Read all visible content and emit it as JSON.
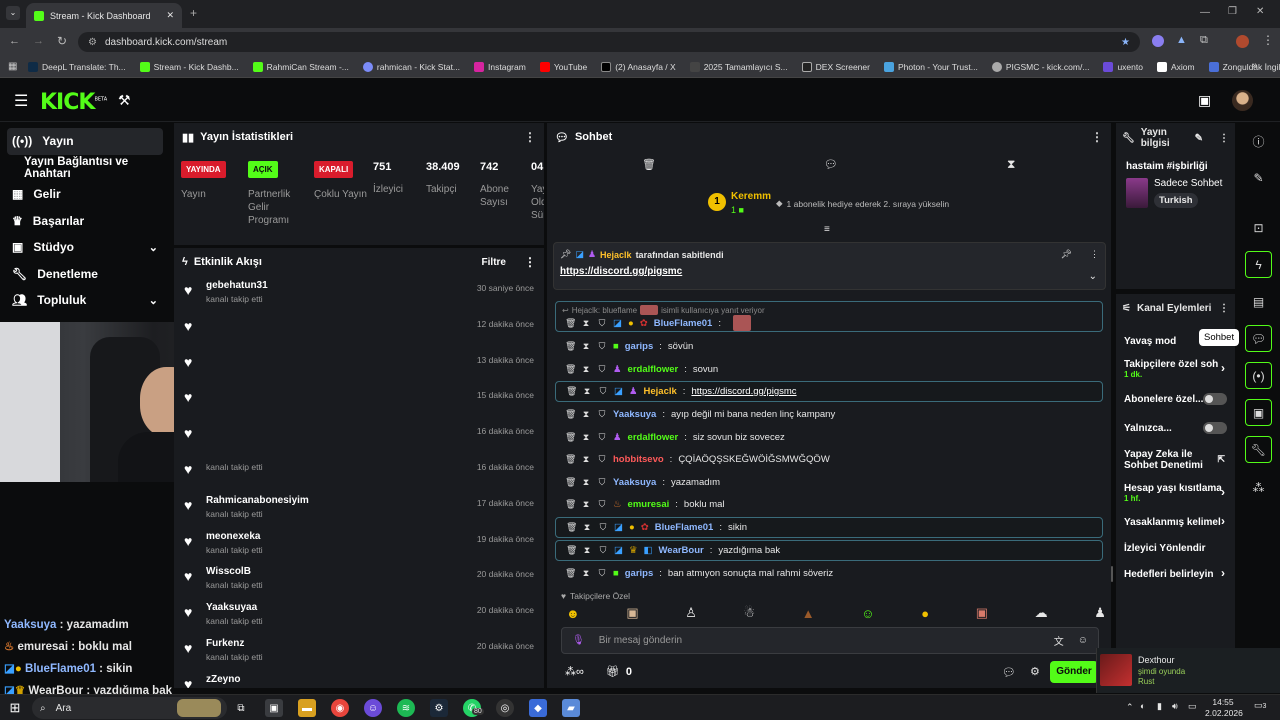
{
  "browser": {
    "tab_title": "Stream - Kick Dashboard",
    "url": "dashboard.kick.com/stream",
    "bookmarks": [
      "DeepL Translate: Th...",
      "Stream - Kick Dashb...",
      "RahmiCan Stream -...",
      "rahmican - Kick Stat...",
      "Instagram",
      "YouTube",
      "(2) Anasayfa / X",
      "2025 Tamamlayıcı S...",
      "DEX Screener",
      "Photon - Your Trust...",
      "PIGSMC - kick.com/...",
      "uxento",
      "Axiom",
      "Zonguldak İngilizce..."
    ]
  },
  "colors": {
    "brand": "#53fc18",
    "panel": "#191b1f",
    "live": "#d91c2c",
    "on": "#53fc18",
    "off": "#d91c2c"
  },
  "header": {
    "logo": "KICK",
    "logo_sup": "BETA"
  },
  "sidebar": {
    "items": [
      {
        "label": "Yayın",
        "icon": "broadcast-icon"
      },
      {
        "label": "Yayın Bağlantısı ve Anahtarı",
        "icon": ""
      },
      {
        "label": "Gelir",
        "icon": "revenue-icon"
      },
      {
        "label": "Başarılar",
        "icon": "trophy-icon"
      },
      {
        "label": "Stüdyo",
        "icon": "studio-icon"
      },
      {
        "label": "Denetleme",
        "icon": "wrench-icon"
      },
      {
        "label": "Topluluk",
        "icon": "community-icon"
      }
    ]
  },
  "stats": {
    "title": "Yayın İstatistikleri",
    "badges": [
      {
        "badge": "YAYINDA",
        "label": "Yayın"
      },
      {
        "badge": "AÇIK",
        "label": "Partnerlik Gelir Programı"
      },
      {
        "badge": "KAPALI",
        "label": "Çoklu Yayın"
      }
    ],
    "numbers": [
      {
        "value": "751",
        "label": "İzleyici"
      },
      {
        "value": "38.409",
        "label": "Takipçi"
      },
      {
        "value": "742",
        "label": "Abone Sayısı"
      },
      {
        "value": "04:",
        "label": "Yay Old Sür"
      }
    ]
  },
  "activity": {
    "title": "Etkinlik Akışı",
    "filter": "Filtre",
    "items": [
      {
        "name": "gebehatun31",
        "sub": "kanalı takip etti",
        "time": "30 saniye önce"
      },
      {
        "name": "",
        "sub": "",
        "time": "12 dakika önce"
      },
      {
        "name": "",
        "sub": "",
        "time": "13 dakika önce"
      },
      {
        "name": "",
        "sub": "",
        "time": "15 dakika önce"
      },
      {
        "name": "",
        "sub": "",
        "time": "16 dakika önce"
      },
      {
        "name": "",
        "sub": "kanalı takip etti",
        "time": "16 dakika önce"
      },
      {
        "name": "Rahmicanabonesiyim",
        "sub": "kanalı takip etti",
        "time": "17 dakika önce"
      },
      {
        "name": "meonexeka",
        "sub": "kanalı takip etti",
        "time": "19 dakika önce"
      },
      {
        "name": "WisscolB",
        "sub": "kanalı takip etti",
        "time": "20 dakika önce"
      },
      {
        "name": "Yaaksuyaa",
        "sub": "kanalı takip etti",
        "time": "20 dakika önce"
      },
      {
        "name": "Furkenz",
        "sub": "kanalı takip etti",
        "time": "20 dakika önce"
      },
      {
        "name": "zZeyno",
        "sub": "",
        "time": ""
      }
    ]
  },
  "overlay_chat": [
    {
      "user": "Yaaksuya",
      "text": "yazamadım",
      "color": "#8fb8ff"
    },
    {
      "user": "emuresai",
      "text": "boklu mal",
      "color": "#ffffff"
    },
    {
      "user": "BlueFlame01",
      "text": "sikin",
      "color": "#8fb8ff"
    },
    {
      "user": "WearBour",
      "text": "yazdığıma bak",
      "color": "#ffffff"
    }
  ],
  "chat": {
    "title": "Sohbet",
    "gift_user": "Keremm",
    "gift_count": "1",
    "gift_text": "1 abonelik hediye ederek 2. sıraya yükselin",
    "pinned_by": "Hejaclk",
    "pinned_suffix": "tarafından sabitlendi",
    "pinned_link": "https://discord.gg/pigsmc",
    "reply_text": "Hejaclk: blueflame",
    "reply_suffix": "isimli kullanıcıya yanıt veriyor",
    "messages": [
      {
        "user": "BlueFlame01",
        "text": "",
        "color": "#8fb8ff",
        "hl": true
      },
      {
        "user": "garips",
        "text": "sövün",
        "color": "#8fb8ff",
        "hl": false
      },
      {
        "user": "erdalflower",
        "text": "sovun",
        "color": "#53fc18",
        "hl": false
      },
      {
        "user": "Hejaclk",
        "text": "https://discord.gg/pigsmc",
        "color": "#ffc02a",
        "hl": true
      },
      {
        "user": "Yaaksuya",
        "text": "ayıp değil mi bana neden linç kampany",
        "color": "#8fb8ff",
        "hl": false
      },
      {
        "user": "erdalflower",
        "text": "siz sovun biz sovecez",
        "color": "#53fc18",
        "hl": false
      },
      {
        "user": "hobbitsevo",
        "text": "ÇQİAÖQŞSKEĞWÖİĞSMWĞQÖW",
        "color": "#ff5a5a",
        "hl": false
      },
      {
        "user": "Yaaksuya",
        "text": "yazamadım",
        "color": "#8fb8ff",
        "hl": false
      },
      {
        "user": "emuresai",
        "text": "boklu mal",
        "color": "#53fc18",
        "hl": false
      },
      {
        "user": "BlueFlame01",
        "text": "sikin",
        "color": "#8fb8ff",
        "hl": true
      },
      {
        "user": "WearBour",
        "text": "yazdığıma bak",
        "color": "#8fb8ff",
        "hl": true
      },
      {
        "user": "garips",
        "text": "ban atmıyon sonuçta mal rahmi söveriz",
        "color": "#8fb8ff",
        "hl": false
      }
    ],
    "followers_only": "Takipçilere Özel",
    "input_placeholder": "Bir mesaj gönderin",
    "viewer_count": "0",
    "send_label": "Gönder"
  },
  "stream_info": {
    "title": "Yayın bilgisi",
    "stream_title": "hastaim #işbirliği",
    "category": "Sadece Sohbet",
    "language": "Turkish"
  },
  "channel_actions": {
    "title": "Kanal Eylemleri",
    "items": [
      {
        "label": "Yavaş mod",
        "sub": "",
        "control": "none"
      },
      {
        "label": "Takipçilere özel soh",
        "sub": "1 dk.",
        "control": "chevron"
      },
      {
        "label": "Abonelere özel...",
        "sub": "",
        "control": "toggle"
      },
      {
        "label": "Yalnızca...",
        "sub": "",
        "control": "toggle"
      },
      {
        "label": "Yapay Zeka ile Sohbet Denetimi",
        "sub": "",
        "control": "external"
      },
      {
        "label": "Hesap yaşı kısıtlama",
        "sub": "1 hf.",
        "control": "chevron"
      },
      {
        "label": "Yasaklanmış kelimel",
        "sub": "",
        "control": "chevron"
      },
      {
        "label": "İzleyici Yönlendir",
        "sub": "",
        "control": "none"
      },
      {
        "label": "Hedefleri belirleyin",
        "sub": "",
        "control": "chevron"
      }
    ]
  },
  "tooltip": "Sohbet",
  "now_playing": {
    "name": "Dexthour",
    "status": "şimdi oyunda",
    "game": "Rust"
  },
  "taskbar": {
    "search": "Ara",
    "time": "14:55",
    "date": "2.02.2026",
    "whatsapp_badge": "80",
    "notif": "3"
  }
}
